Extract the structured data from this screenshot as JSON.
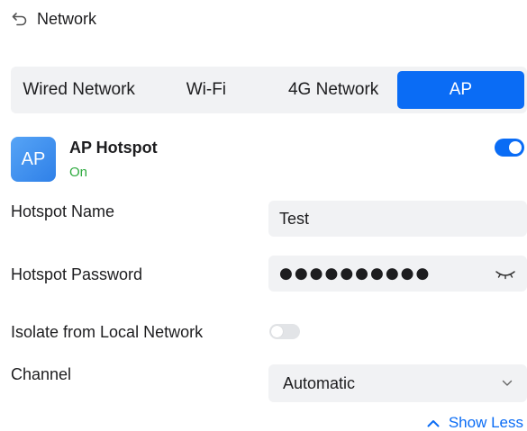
{
  "header": {
    "title": "Network",
    "back_icon": "back-arrow-icon"
  },
  "tabs": [
    {
      "label": "Wired Network",
      "active": false
    },
    {
      "label": "Wi-Fi",
      "active": false
    },
    {
      "label": "4G Network",
      "active": false
    },
    {
      "label": "AP",
      "active": true
    }
  ],
  "ap_hotspot": {
    "icon_text": "AP",
    "title": "AP Hotspot",
    "status": "On",
    "enabled": true
  },
  "hotspot_name": {
    "label": "Hotspot Name",
    "value": "Test"
  },
  "hotspot_password": {
    "label": "Hotspot Password",
    "masked_value": "●●●●●●●●●●",
    "eye_icon": "eye-closed-icon"
  },
  "isolate": {
    "label": "Isolate from Local Network",
    "enabled": false
  },
  "channel": {
    "label": "Channel",
    "value": "Automatic",
    "icon": "chevron-down-icon"
  },
  "show_less": {
    "label": "Show Less",
    "icon": "chevron-up-icon"
  },
  "colors": {
    "accent": "#0a6cf5",
    "status_on": "#2eaa3f",
    "field_bg": "#f1f2f4",
    "toggle_off": "#e2e4e7"
  }
}
